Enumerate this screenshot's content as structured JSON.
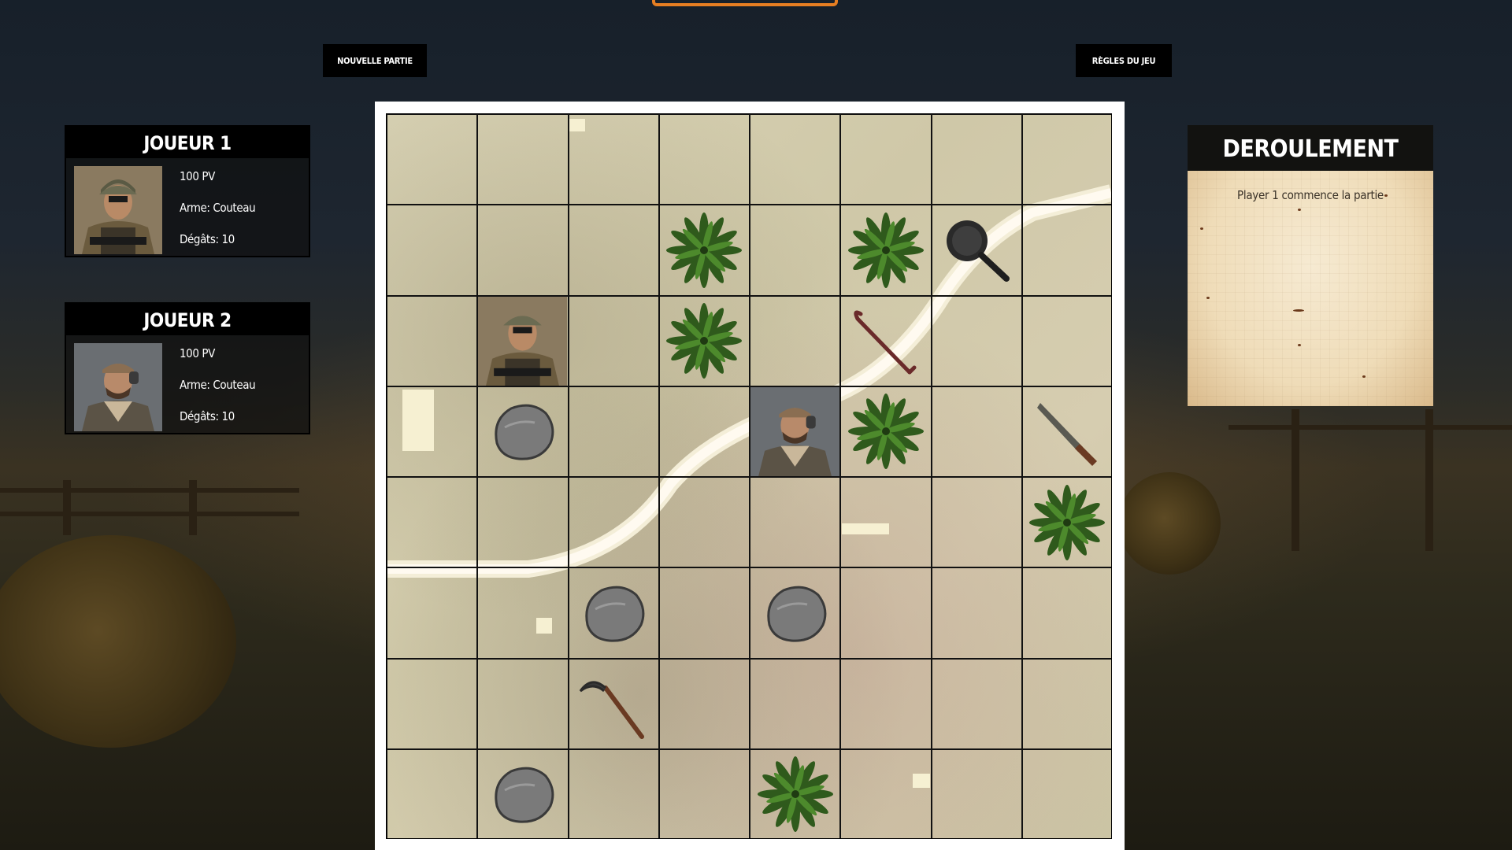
{
  "buttons": {
    "new_game": "NOUVELLE PARTIE",
    "rules": "RÈGLES DU JEU"
  },
  "players": [
    {
      "title": "JOUEUR 1",
      "hp": "100 PV",
      "weapon": "Arme: Couteau",
      "damage": "Dégâts: 10",
      "portrait": "soldier-helmet"
    },
    {
      "title": "JOUEUR 2",
      "hp": "100 PV",
      "weapon": "Arme: Couteau",
      "damage": "Dégâts: 10",
      "portrait": "soldier-cap"
    }
  ],
  "log": {
    "title": "DEROULEMENT",
    "entries": [
      "Player 1 commence la partie"
    ]
  },
  "board": {
    "size": 8,
    "cells": [
      [
        "empty",
        "empty",
        "empty",
        "empty",
        "empty",
        "empty",
        "empty",
        "empty"
      ],
      [
        "empty",
        "empty",
        "empty",
        "tree",
        "empty",
        "tree",
        "pan",
        "empty"
      ],
      [
        "empty",
        "player1",
        "empty",
        "tree",
        "empty",
        "crowbar",
        "empty",
        "empty"
      ],
      [
        "empty",
        "rock",
        "empty",
        "empty",
        "player2",
        "tree",
        "empty",
        "machete"
      ],
      [
        "empty",
        "empty",
        "empty",
        "empty",
        "empty",
        "empty",
        "empty",
        "tree"
      ],
      [
        "empty",
        "empty",
        "rock",
        "empty",
        "rock",
        "empty",
        "empty",
        "empty"
      ],
      [
        "empty",
        "empty",
        "sickle",
        "empty",
        "empty",
        "empty",
        "empty",
        "empty"
      ],
      [
        "empty",
        "rock",
        "empty",
        "empty",
        "tree",
        "empty",
        "empty",
        "empty"
      ]
    ]
  },
  "colors": {
    "accent": "#e67e22",
    "panel": "#000000",
    "paper": "#f3e4c6"
  }
}
